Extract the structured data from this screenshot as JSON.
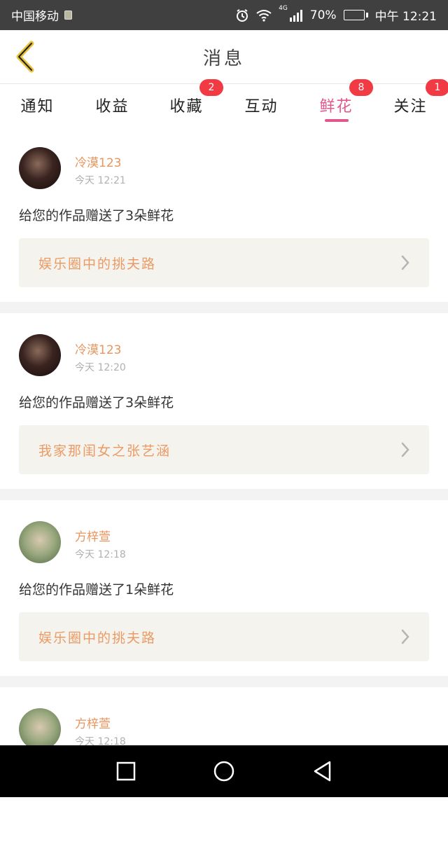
{
  "status_bar": {
    "carrier": "中国移动",
    "network": "4G",
    "battery": "70%",
    "time": "中午 12:21"
  },
  "header": {
    "title": "消息"
  },
  "tabs": [
    {
      "label": "通知",
      "badge": null,
      "active": false
    },
    {
      "label": "收益",
      "badge": null,
      "active": false
    },
    {
      "label": "收藏",
      "badge": "2",
      "active": false
    },
    {
      "label": "互动",
      "badge": null,
      "active": false
    },
    {
      "label": "鲜花",
      "badge": "8",
      "active": true
    },
    {
      "label": "关注",
      "badge": "1",
      "active": false
    }
  ],
  "messages": [
    {
      "name": "冷漠123",
      "time": "今天 12:21",
      "text": "给您的作品赠送了3朵鲜花",
      "work": "娱乐圈中的挑夫路"
    },
    {
      "name": "冷漠123",
      "time": "今天 12:20",
      "text": "给您的作品赠送了3朵鲜花",
      "work": "我家那闺女之张艺涵"
    },
    {
      "name": "方梓萱",
      "time": "今天 12:18",
      "text": "给您的作品赠送了1朵鲜花",
      "work": "娱乐圈中的挑夫路"
    },
    {
      "name": "方梓萱",
      "time": "今天 12:18",
      "text": "",
      "work": ""
    }
  ],
  "colors": {
    "accent_pink": "#e2588c",
    "name_orange": "#e8955e",
    "badge_red": "#f23a44"
  },
  "icons": {
    "back": "chevron-left-icon",
    "link": "chevron-right-icon",
    "nav": [
      "square-icon",
      "circle-icon",
      "triangle-back-icon"
    ]
  }
}
